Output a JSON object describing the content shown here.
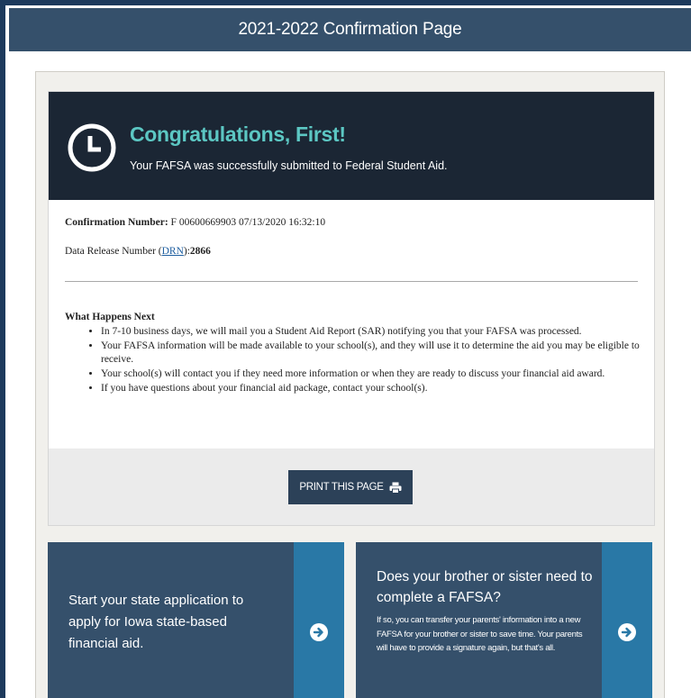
{
  "header": {
    "title": "2021-2022 Confirmation Page"
  },
  "banner": {
    "icon": "clock-icon",
    "heading": "Congratulations, First!",
    "message": "Your FAFSA was successfully submitted to Federal Student Aid."
  },
  "confirmation": {
    "label": "Confirmation Number:",
    "value": "F 00600669903 07/13/2020 16:32:10"
  },
  "drn": {
    "label_prefix": "Data Release Number (",
    "link_text": "DRN",
    "label_suffix": "):",
    "value": "2866"
  },
  "what_next": {
    "heading": "What Happens Next",
    "items": [
      "In 7-10 business days, we will mail you a Student Aid Report (SAR) notifying you that your FAFSA was processed.",
      "Your FAFSA information will be made available to your school(s), and they will use it to determine the aid you may be eligible to receive.",
      "Your school(s) will contact you if they need more information or when they are ready to discuss your financial aid award.",
      "If you have questions about your financial aid package, contact your school(s)."
    ]
  },
  "print": {
    "label": "PRINT THIS PAGE",
    "icon": "printer-icon"
  },
  "tiles": [
    {
      "text": "Start your state application to apply for Iowa state-based financial aid.",
      "icon": "arrow-right-circle-icon"
    },
    {
      "heading": "Does your brother or sister need to complete a FAFSA?",
      "body": "If so, you can transfer your parents' information into a new FAFSA for your brother or sister to save time. Your parents will have to provide a signature again, but that's all.",
      "icon": "arrow-right-circle-icon"
    }
  ],
  "colors": {
    "titlebar": "#35506b",
    "banner": "#1b2634",
    "accent": "#5cc7c3",
    "tile": "#35506b",
    "tile_arrow": "#2978a6",
    "button": "#2c4158"
  }
}
